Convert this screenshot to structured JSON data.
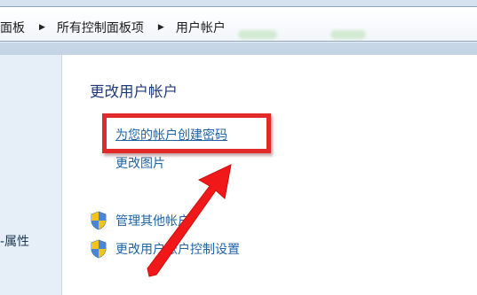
{
  "breadcrumb": {
    "items": [
      "面板",
      "所有控制面板项",
      "用户帐户"
    ]
  },
  "left_pane": {
    "items": [
      "‑属性"
    ]
  },
  "main": {
    "title": "更改用户帐户",
    "tasks": [
      {
        "label": "为您的帐户创建密码",
        "icon": null,
        "highlighted": true
      },
      {
        "label": "更改图片",
        "icon": null,
        "highlighted": false
      },
      {
        "label": "管理其他帐户",
        "icon": "uac-shield-icon",
        "highlighted": false
      },
      {
        "label": "更改用户帐户控制设置",
        "icon": "uac-shield-icon",
        "highlighted": false
      }
    ]
  },
  "colors": {
    "link": "#1f63a6",
    "title": "#1f3a7a",
    "annotation_red": "#e12b2b",
    "left_pane_bg": "#e6eef7"
  }
}
